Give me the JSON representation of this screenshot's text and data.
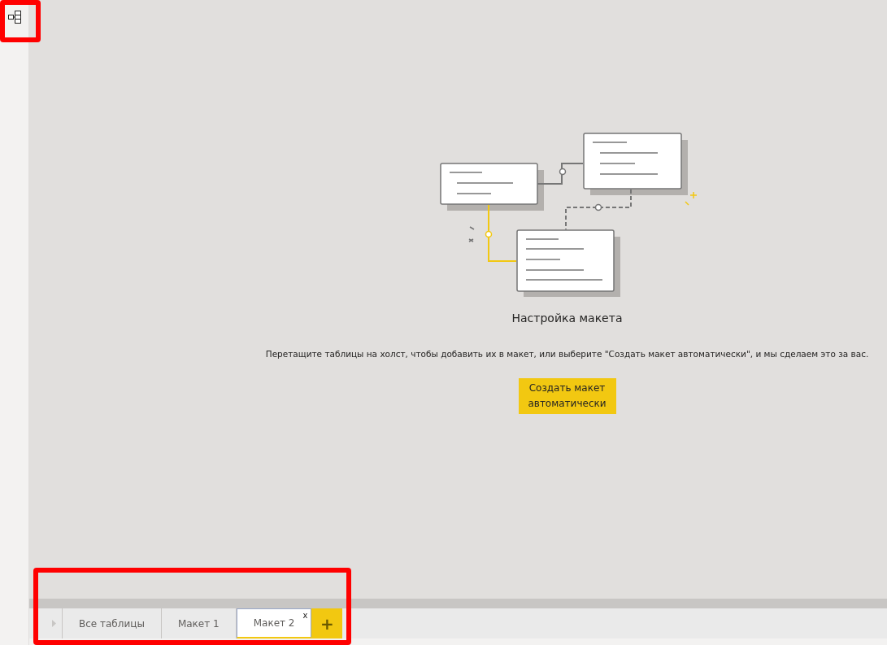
{
  "empty_state": {
    "title": "Настройка макета",
    "description": "Перетащите таблицы на холст, чтобы добавить их в макет, или выберите \"Создать макет автоматически\", и мы сделаем это за вас.",
    "button": "Создать макет автоматически"
  },
  "tabs": [
    {
      "label": "Все таблицы",
      "selected": false
    },
    {
      "label": "Макет 1",
      "selected": false
    },
    {
      "label": "Макет 2",
      "selected": true,
      "close": "x"
    }
  ],
  "add_tab": "+"
}
